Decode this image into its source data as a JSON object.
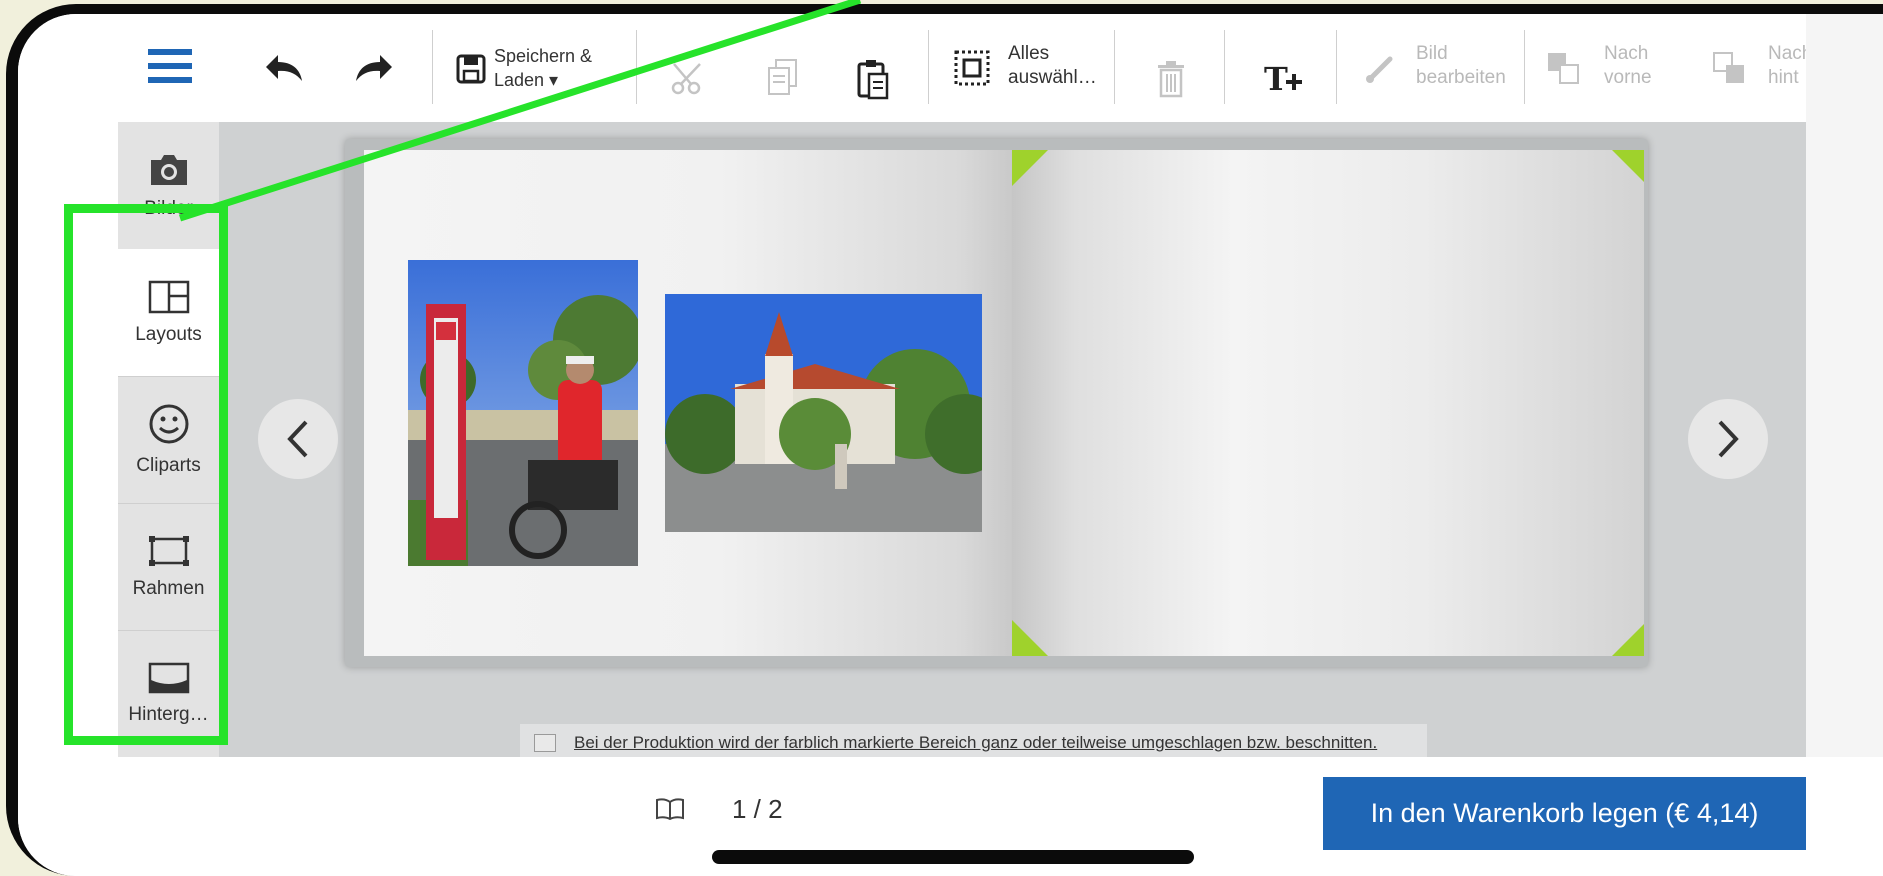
{
  "toolbar": {
    "menu_icon": "hamburger-menu-icon",
    "undo_icon": "undo-arrow-icon",
    "redo_icon": "redo-arrow-icon",
    "save_label_line1": "Speichern &",
    "save_label_line2": "Laden ▾",
    "cut_icon": "scissors-icon",
    "copy_icon": "copy-icon",
    "paste_icon": "paste-icon",
    "select_all_line1": "Alles",
    "select_all_line2": "auswähl…",
    "delete_icon": "trash-icon",
    "add_text_icon": "add-text-icon",
    "edit_image_line1": "Bild",
    "edit_image_line2": "bearbeiten",
    "bring_forward_line1": "Nach",
    "bring_forward_line2": "vorne",
    "send_back_line1": "Nach",
    "send_back_line2": "hint"
  },
  "sidebar": {
    "items": [
      {
        "label": "Bilder",
        "icon": "camera-icon"
      },
      {
        "label": "Layouts",
        "icon": "layout-icon"
      },
      {
        "label": "Cliparts",
        "icon": "smiley-icon"
      },
      {
        "label": "Rahmen",
        "icon": "frame-icon"
      },
      {
        "label": "Hinterg…",
        "icon": "background-icon"
      }
    ]
  },
  "editor": {
    "notice": "Bei der Produktion wird der farblich markierte Bereich ganz oder teilweise umgeschlagen bzw. beschnitten."
  },
  "footer": {
    "page_counter": "1 / 2",
    "cart_button": "In den Warenkorb legen (€ 4,14)"
  },
  "colors": {
    "accent": "#1f66b5",
    "highlight": "#26e32a",
    "corner_marker": "#9fd22c"
  }
}
